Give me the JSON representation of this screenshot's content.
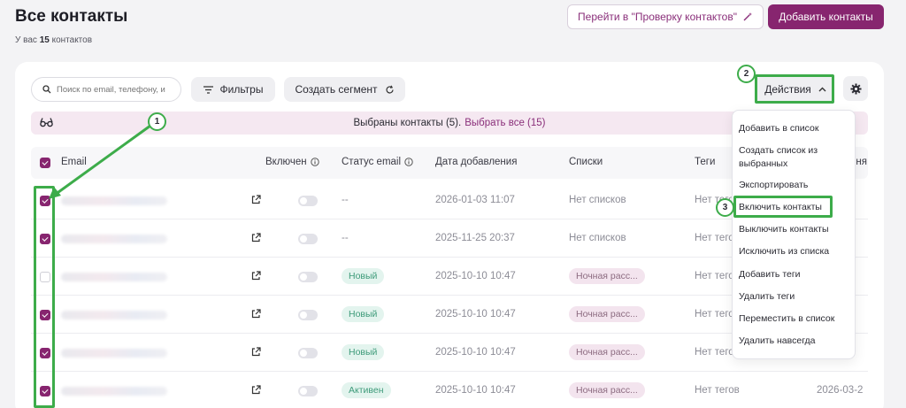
{
  "header": {
    "title": "Все контакты",
    "subtitle_prefix": "У вас",
    "subtitle_count": "15",
    "subtitle_suffix": "контактов",
    "check_button": "Перейти в \"Проверку контактов\"",
    "add_button": "Добавить контакты"
  },
  "toolbar": {
    "search_placeholder": "Поиск по email, телефону, и",
    "filters_label": "Фильтры",
    "segment_label": "Создать сегмент",
    "actions_label": "Действия"
  },
  "selection": {
    "text": "Выбраны контакты (5).",
    "select_all": "Выбрать все (15)"
  },
  "columns": {
    "email": "Email",
    "enabled": "Включен",
    "email_status": "Статус email",
    "date_added": "Дата добавления",
    "lists": "Списки",
    "tags": "Теги",
    "last": "ння"
  },
  "rows": [
    {
      "checked": true,
      "status": "--",
      "date": "2026-01-03 11:07",
      "list": "Нет списков",
      "tags": "Нет тегов",
      "extra": ""
    },
    {
      "checked": true,
      "status": "--",
      "date": "2025-11-25 20:37",
      "list": "Нет списков",
      "tags": "Нет тегов",
      "extra": ""
    },
    {
      "checked": false,
      "status": "Новый",
      "date": "2025-10-10 10:47",
      "list": "Ночная расс...",
      "tags": "Нет тегов",
      "extra": ""
    },
    {
      "checked": true,
      "status": "Новый",
      "date": "2025-10-10 10:47",
      "list": "Ночная расс...",
      "tags": "Нет тегов",
      "extra": ""
    },
    {
      "checked": true,
      "status": "Новый",
      "date": "2025-10-10 10:47",
      "list": "Ночная расс...",
      "tags": "Нет тегов",
      "extra": ""
    },
    {
      "checked": true,
      "status": "Активен",
      "date": "2025-10-10 10:47",
      "list": "Ночная расс...",
      "tags": "Нет тегов",
      "extra": "2026-03-2"
    }
  ],
  "actions_menu": [
    "Добавить в список",
    "Создать список из выбранных",
    "Экспортировать",
    "Включить контакты",
    "Выключить контакты",
    "Исключить из списка",
    "Добавить теги",
    "Удалить теги",
    "Переместить в список",
    "Удалить навсегда"
  ],
  "annotations": {
    "step1": "1",
    "step2": "2",
    "step3": "3",
    "color": "#3dac4a"
  },
  "colors": {
    "brand": "#87256f",
    "selection_bg": "#f5e8f1",
    "status_green": "#3e9b7a"
  },
  "icons": [
    "search-icon",
    "filter-icon",
    "refresh-icon",
    "chevron-up-icon",
    "gear-icon",
    "glasses-icon",
    "external-link-icon",
    "info-icon",
    "magic-wand-icon"
  ]
}
